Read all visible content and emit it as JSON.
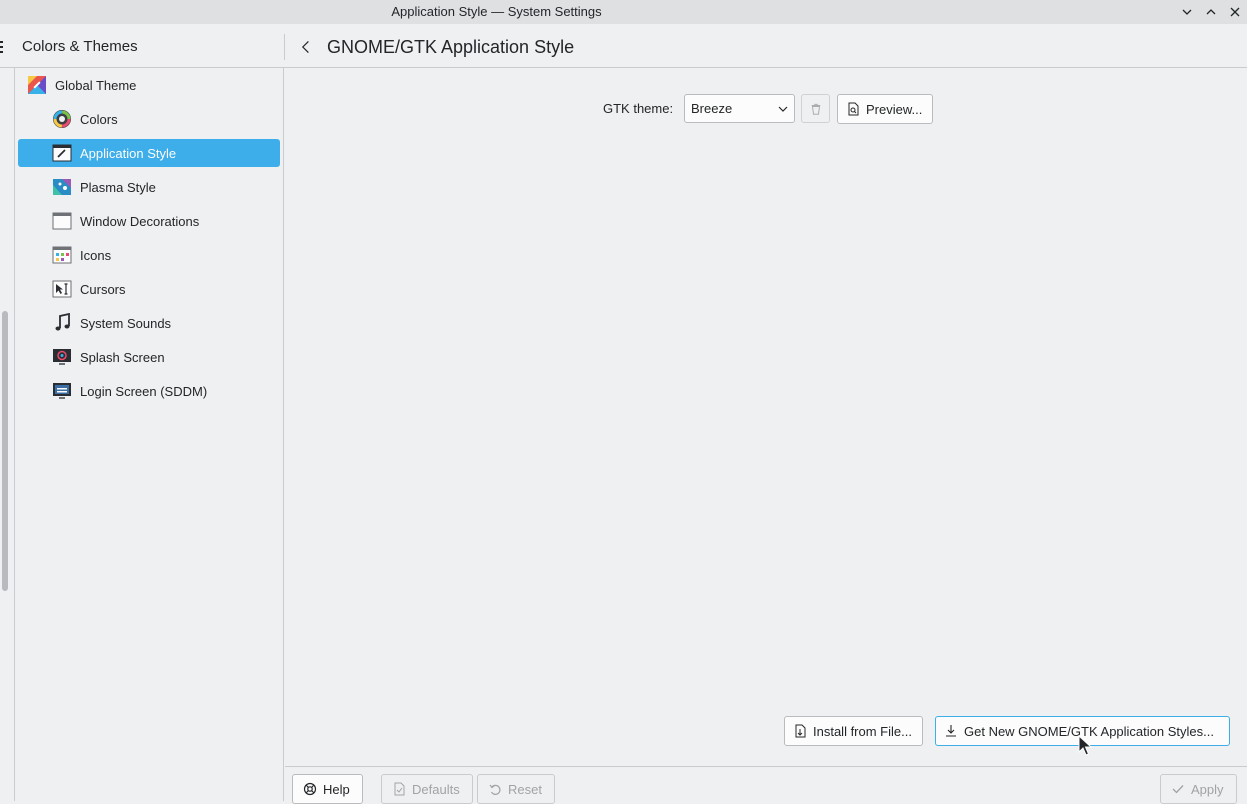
{
  "window": {
    "title": "Application Style — System Settings"
  },
  "header": {
    "section_title": "Colors & Themes",
    "page_title": "GNOME/GTK Application Style"
  },
  "sidebar": {
    "items": [
      {
        "label": "Global Theme",
        "icon": "global-theme-icon",
        "active": false
      },
      {
        "label": "Colors",
        "icon": "colors-icon",
        "active": false
      },
      {
        "label": "Application Style",
        "icon": "application-style-icon",
        "active": true
      },
      {
        "label": "Plasma Style",
        "icon": "plasma-style-icon",
        "active": false
      },
      {
        "label": "Window Decorations",
        "icon": "window-decorations-icon",
        "active": false
      },
      {
        "label": "Icons",
        "icon": "icons-icon",
        "active": false
      },
      {
        "label": "Cursors",
        "icon": "cursors-icon",
        "active": false
      },
      {
        "label": "System Sounds",
        "icon": "music-note-icon",
        "active": false
      },
      {
        "label": "Splash Screen",
        "icon": "splash-screen-icon",
        "active": false
      },
      {
        "label": "Login Screen (SDDM)",
        "icon": "login-screen-icon",
        "active": false
      }
    ]
  },
  "main": {
    "gtk_theme_label": "GTK theme:",
    "gtk_theme_value": "Breeze",
    "preview_label": "Preview...",
    "install_label": "Install from File...",
    "get_new_label": "Get New GNOME/GTK Application Styles..."
  },
  "footer": {
    "help_label": "Help",
    "defaults_label": "Defaults",
    "reset_label": "Reset",
    "apply_label": "Apply"
  },
  "colors": {
    "accent": "#3daee9",
    "background": "#eff0f1",
    "titlebar": "#dee0e2",
    "text": "#232629",
    "disabled_text": "#a0a3a6"
  }
}
